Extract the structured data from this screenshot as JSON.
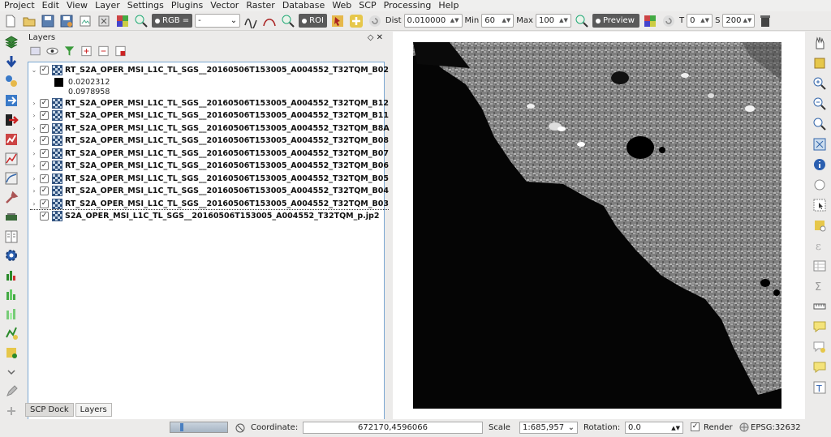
{
  "menu": [
    "Project",
    "Edit",
    "View",
    "Layer",
    "Settings",
    "Plugins",
    "Vector",
    "Raster",
    "Database",
    "Web",
    "SCP",
    "Processing",
    "Help"
  ],
  "toolbar": {
    "rgb_label": "RGB =",
    "rgb_value": "-",
    "roi_label": "ROI",
    "dist_label": "Dist",
    "dist_value": "0.010000",
    "min_label": "Min",
    "min_value": "60",
    "max_label": "Max",
    "max_value": "100",
    "preview_label": "Preview",
    "t_label": "T",
    "t_value": "0",
    "s_label": "S",
    "s_value": "200"
  },
  "layers_panel": {
    "title": "Layers",
    "items": [
      {
        "name": "RT_S2A_OPER_MSI_L1C_TL_SGS__20160506T153005_A004552_T32TQM_B02",
        "expanded": true
      },
      {
        "name": "RT_S2A_OPER_MSI_L1C_TL_SGS__20160506T153005_A004552_T32TQM_B12"
      },
      {
        "name": "RT_S2A_OPER_MSI_L1C_TL_SGS__20160506T153005_A004552_T32TQM_B11"
      },
      {
        "name": "RT_S2A_OPER_MSI_L1C_TL_SGS__20160506T153005_A004552_T32TQM_B8A"
      },
      {
        "name": "RT_S2A_OPER_MSI_L1C_TL_SGS__20160506T153005_A004552_T32TQM_B08"
      },
      {
        "name": "RT_S2A_OPER_MSI_L1C_TL_SGS__20160506T153005_A004552_T32TQM_B07"
      },
      {
        "name": "RT_S2A_OPER_MSI_L1C_TL_SGS__20160506T153005_A004552_T32TQM_B06"
      },
      {
        "name": "RT_S2A_OPER_MSI_L1C_TL_SGS__20160506T153005_A004552_T32TQM_B05"
      },
      {
        "name": "RT_S2A_OPER_MSI_L1C_TL_SGS__20160506T153005_A004552_T32TQM_B04"
      },
      {
        "name": "RT_S2A_OPER_MSI_L1C_TL_SGS__20160506T153005_A004552_T32TQM_B03"
      },
      {
        "name": "S2A_OPER_MSI_L1C_TL_SGS__20160506T153005_A004552_T32TQM_p.jp2"
      }
    ],
    "legend_min": "0.0202312",
    "legend_max": "0.0978958"
  },
  "tabs": [
    "SCP Dock",
    "Layers"
  ],
  "status": {
    "coordinate_label": "Coordinate:",
    "coordinate_value": "672170,4596066",
    "scale_label": "Scale",
    "scale_value": "1:685,957",
    "rotation_label": "Rotation:",
    "rotation_value": "0.0",
    "render_label": "Render",
    "crs": "EPSG:32632"
  },
  "colors": {
    "accent": "#7aa7d2",
    "selected_tab": "#f3f3f2"
  }
}
